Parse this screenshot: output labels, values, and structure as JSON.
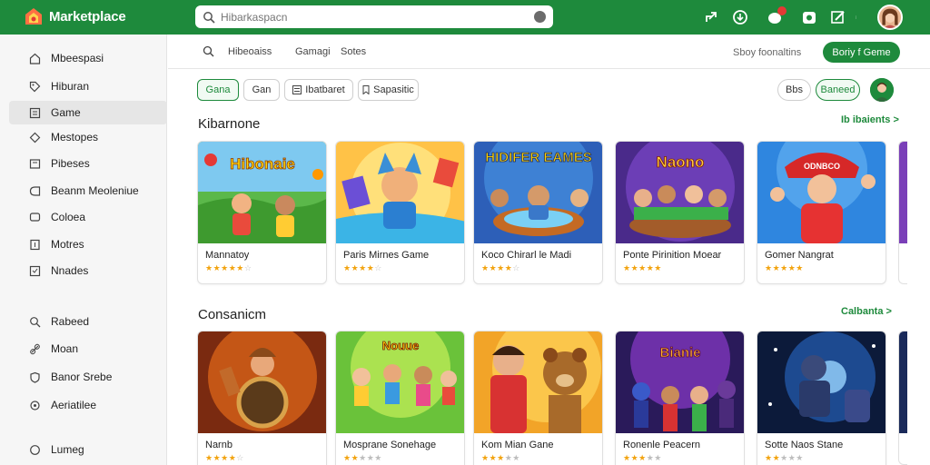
{
  "app": {
    "name": "Marketplace",
    "brand_color": "#1e8a3c"
  },
  "search": {
    "placeholder": "Hibarkaspacn"
  },
  "sidebar": {
    "items": [
      {
        "label": "Mbeespasi",
        "icon": "home-icon"
      },
      {
        "label": "Hiburan",
        "icon": "tag-icon"
      },
      {
        "label": "Game",
        "icon": "gamepad-icon",
        "active": true
      },
      {
        "label": "Mestopes",
        "icon": "diamond-icon"
      },
      {
        "label": "Pibeses",
        "icon": "folder-icon"
      },
      {
        "label": "Beanm Meoleniue",
        "icon": "tag-icon"
      },
      {
        "label": "Coloea",
        "icon": "chat-icon"
      },
      {
        "label": "Motres",
        "icon": "document-icon"
      },
      {
        "label": "Nnades",
        "icon": "star-icon"
      },
      {
        "label": "Rabeed",
        "icon": "search-icon"
      },
      {
        "label": "Moan",
        "icon": "link-icon"
      },
      {
        "label": "Banor Srebe",
        "icon": "shield-icon"
      },
      {
        "label": "Aeriatilee",
        "icon": "gear-icon"
      },
      {
        "label": "Lumeg",
        "icon": "logout-icon"
      }
    ]
  },
  "subnav": {
    "tabs": [
      "Hibeoaiss",
      "Gamagi",
      "Sotes"
    ],
    "right_link": "Sboy foonaltins",
    "cta": "Boriy f Geme"
  },
  "filters": {
    "chips": [
      "Gana",
      "Gan",
      "Ibatbaret",
      "Sapasitic"
    ],
    "right_chips": [
      "Bbs",
      "Baneed"
    ]
  },
  "sections": [
    {
      "title": "Kibarnone",
      "link": "Ib ibaients >",
      "cards": [
        {
          "name": "Mannatoy",
          "rating": 5
        },
        {
          "name": "Paris Mirnes Game",
          "rating": 4
        },
        {
          "name": "Koco Chirarl le Madi",
          "rating": 4
        },
        {
          "name": "Ponte Pirinition Moear",
          "rating": 5
        },
        {
          "name": "Gomer Nangrat",
          "rating": 5
        }
      ]
    },
    {
      "title": "Consanicm",
      "link": "Calbanta >",
      "cards": [
        {
          "name": "Narnb",
          "rating": 4
        },
        {
          "name": "Mosprane Sonehage",
          "rating": 2
        },
        {
          "name": "Kom Mian Gane",
          "rating": 3
        },
        {
          "name": "Ronenle Peacern",
          "rating": 3
        },
        {
          "name": "Sotte Naos Stane",
          "rating": 2
        }
      ]
    }
  ],
  "thumb_overlay_texts": [
    "Hibonaie",
    "HIDIFER EAMES",
    "Naono",
    "Bianie",
    "ODNBCO"
  ]
}
